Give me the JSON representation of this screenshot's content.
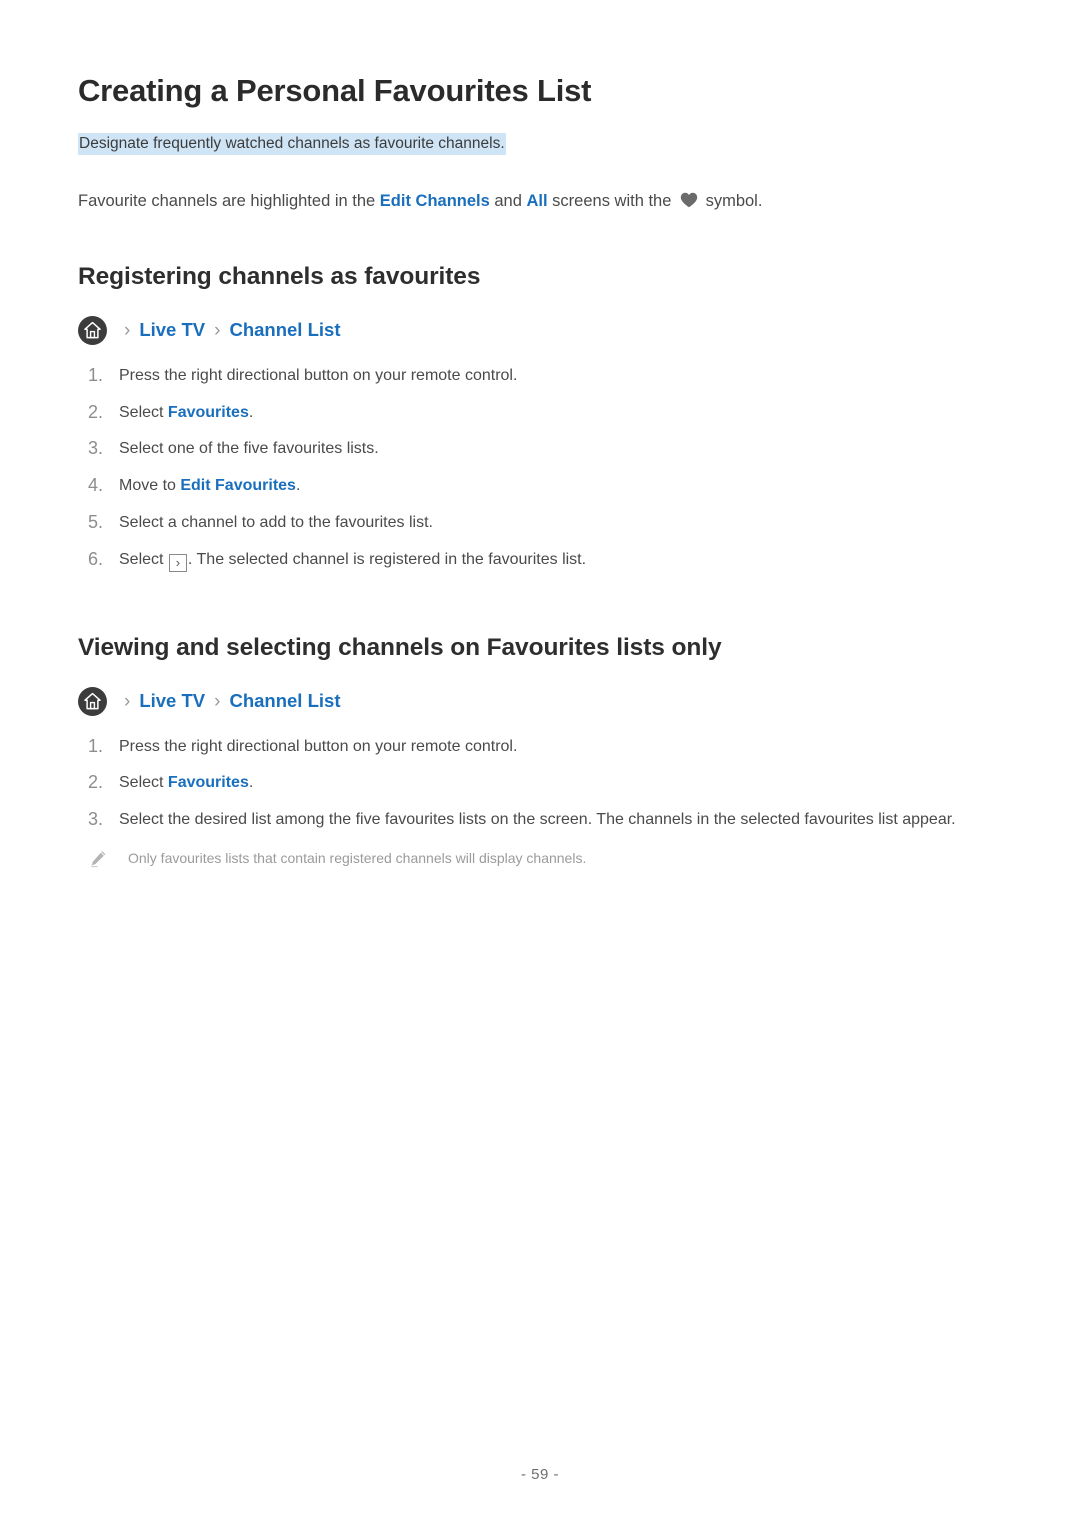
{
  "document": {
    "title": "Creating a Personal Favourites List",
    "subtitle_highlighted": "Designate frequently watched channels as favourite channels.",
    "intro": {
      "part1": "Favourite channels are highlighted in the ",
      "link1": "Edit Channels",
      "part2": " and ",
      "link2": "All",
      "part3": " screens with the ",
      "heart_icon": "heart-icon",
      "part4": " symbol."
    }
  },
  "sections": [
    {
      "heading": "Registering channels as favourites",
      "breadcrumb": {
        "home_icon": "home-icon",
        "separator": "›",
        "items": [
          "Live TV",
          "Channel List"
        ]
      },
      "steps": [
        {
          "num": "1.",
          "text": "Press the right directional button on your remote control."
        },
        {
          "num": "2.",
          "pre": "Select ",
          "link": "Favourites",
          "post": "."
        },
        {
          "num": "3.",
          "text": "Select one of the five favourites lists."
        },
        {
          "num": "4.",
          "pre": "Move to ",
          "link": "Edit Favourites",
          "post": "."
        },
        {
          "num": "5.",
          "text": "Select a channel to add to the favourites list."
        },
        {
          "num": "6.",
          "pre": "Select ",
          "key": "›",
          "post": ". The selected channel is registered in the favourites list."
        }
      ]
    },
    {
      "heading": "Viewing and selecting channels on Favourites lists only",
      "breadcrumb": {
        "home_icon": "home-icon",
        "separator": "›",
        "items": [
          "Live TV",
          "Channel List"
        ]
      },
      "steps": [
        {
          "num": "1.",
          "text": "Press the right directional button on your remote control."
        },
        {
          "num": "2.",
          "pre": "Select ",
          "link": "Favourites",
          "post": "."
        },
        {
          "num": "3.",
          "text": "Select the desired list among the five favourites lists on the screen. The channels in the selected favourites list appear."
        }
      ],
      "note": {
        "icon": "pencil-icon",
        "text": "Only favourites lists that contain registered channels will display channels."
      }
    }
  ],
  "footer": {
    "page_number": "- 59 -"
  },
  "colors": {
    "link": "#1a6fbd",
    "highlight": "#cfe5f6",
    "heading": "#2b2b2b",
    "body": "#4a4a4a",
    "note": "#9b9b9b",
    "step_number": "#8d8d8d"
  }
}
